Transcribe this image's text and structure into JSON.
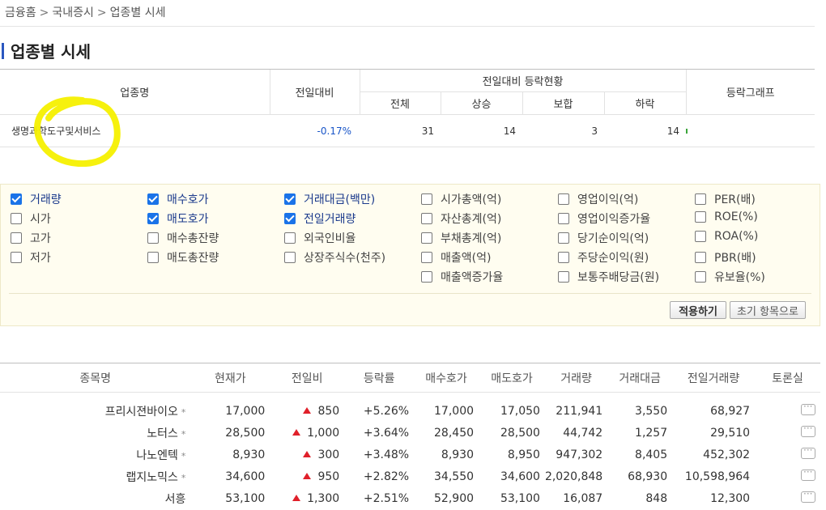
{
  "breadcrumb": [
    "금융홈",
    "국내증시",
    "업종별 시세"
  ],
  "page_title": "업종별 시세",
  "sector_table": {
    "header": {
      "name": "업종명",
      "change": "전일대비",
      "status_group": "전일대비 등락현황",
      "total": "전체",
      "rise": "상승",
      "flat": "보합",
      "fall": "하락",
      "graph": "등락그래프"
    },
    "row": {
      "name": "생명과학도구및서비스",
      "change": "-0.17%",
      "total": "31",
      "rise": "14",
      "flat": "3",
      "fall": "14"
    }
  },
  "options": [
    {
      "label": "거래량",
      "checked": true
    },
    {
      "label": "매수호가",
      "checked": true
    },
    {
      "label": "거래대금(백만)",
      "checked": true
    },
    {
      "label": "시가총액(억)",
      "checked": false
    },
    {
      "label": "영업이익(억)",
      "checked": false
    },
    {
      "label": "PER(배)",
      "checked": false
    },
    {
      "label": "시가",
      "checked": false
    },
    {
      "label": "매도호가",
      "checked": true
    },
    {
      "label": "전일거래량",
      "checked": true
    },
    {
      "label": "자산총계(억)",
      "checked": false
    },
    {
      "label": "영업이익증가율",
      "checked": false
    },
    {
      "label": "ROE(%)",
      "checked": false
    },
    {
      "label": "고가",
      "checked": false
    },
    {
      "label": "매수총잔량",
      "checked": false
    },
    {
      "label": "외국인비율",
      "checked": false
    },
    {
      "label": "부채총계(억)",
      "checked": false
    },
    {
      "label": "당기순이익(억)",
      "checked": false
    },
    {
      "label": "ROA(%)",
      "checked": false
    },
    {
      "label": "저가",
      "checked": false
    },
    {
      "label": "매도총잔량",
      "checked": false
    },
    {
      "label": "상장주식수(천주)",
      "checked": false
    },
    {
      "label": "매출액(억)",
      "checked": false
    },
    {
      "label": "주당순이익(원)",
      "checked": false
    },
    {
      "label": "PBR(배)",
      "checked": false
    },
    {
      "label": "매출액증가율",
      "checked": false
    },
    {
      "label": "보통주배당금(원)",
      "checked": false
    },
    {
      "label": "유보율(%)",
      "checked": false
    }
  ],
  "buttons": {
    "apply": "적용하기",
    "reset": "초기 항목으로"
  },
  "stock_table": {
    "headers": [
      "종목명",
      "현재가",
      "전일비",
      "등락률",
      "매수호가",
      "매도호가",
      "거래량",
      "거래대금",
      "전일거래량",
      "토론실"
    ],
    "rows": [
      {
        "name": "프리시젼바이오",
        "star": "*",
        "price": "17,000",
        "diff": "850",
        "rate": "+5.26%",
        "bid": "17,000",
        "ask": "17,050",
        "volume": "211,941",
        "amount": "3,550",
        "prev_volume": "68,927"
      },
      {
        "name": "노터스",
        "star": "*",
        "price": "28,500",
        "diff": "1,000",
        "rate": "+3.64%",
        "bid": "28,450",
        "ask": "28,500",
        "volume": "44,742",
        "amount": "1,257",
        "prev_volume": "29,510"
      },
      {
        "name": "나노엔텍",
        "star": "*",
        "price": "8,930",
        "diff": "300",
        "rate": "+3.48%",
        "bid": "8,930",
        "ask": "8,950",
        "volume": "947,302",
        "amount": "8,405",
        "prev_volume": "452,302"
      },
      {
        "name": "랩지노믹스",
        "star": "*",
        "price": "34,600",
        "diff": "950",
        "rate": "+2.82%",
        "bid": "34,550",
        "ask": "34,600",
        "volume": "2,020,848",
        "amount": "68,930",
        "prev_volume": "10,598,964"
      },
      {
        "name": "서흥",
        "star": "",
        "price": "53,100",
        "diff": "1,300",
        "rate": "+2.51%",
        "bid": "52,900",
        "ask": "53,100",
        "volume": "16,087",
        "amount": "848",
        "prev_volume": "12,300"
      }
    ]
  },
  "colors": {
    "up": "#e0202a",
    "down": "#1a56c8",
    "accent": "#2b57c0",
    "checkbox": "#1a73e8",
    "highlight": "#f5f000"
  }
}
